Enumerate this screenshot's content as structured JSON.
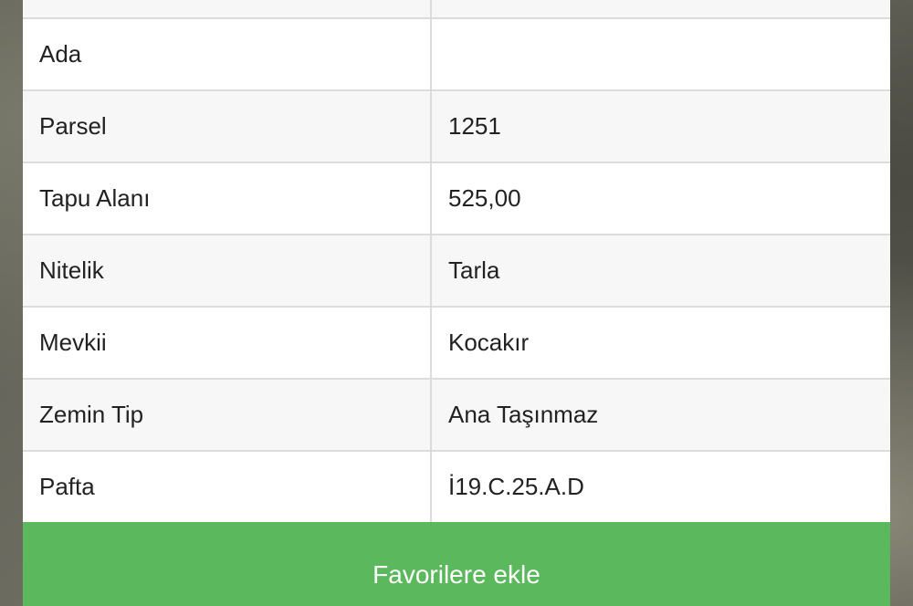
{
  "table": {
    "rows": [
      {
        "label": "",
        "value": ""
      },
      {
        "label": "Ada",
        "value": ""
      },
      {
        "label": "Parsel",
        "value": "1251"
      },
      {
        "label": "Tapu Alanı",
        "value": "525,00"
      },
      {
        "label": "Nitelik",
        "value": "Tarla"
      },
      {
        "label": "Mevkii",
        "value": "Kocakır"
      },
      {
        "label": "Zemin Tip",
        "value": "Ana Taşınmaz"
      },
      {
        "label": "Pafta",
        "value": "İ19.C.25.A.D"
      }
    ]
  },
  "actions": {
    "favorite_label": "Favorilere ekle",
    "favorite_color": "#5cb85c"
  },
  "colors": {
    "row_alt": "#f7f7f7",
    "row": "#ffffff",
    "border": "#dcdcdc"
  }
}
